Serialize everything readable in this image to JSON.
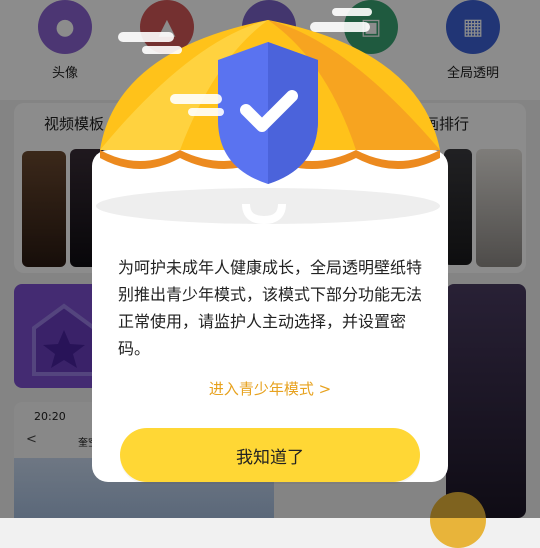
{
  "categories": [
    {
      "label": "头像",
      "icon": "avatar-icon",
      "color": "#8a63d2"
    },
    {
      "label": "",
      "icon": "shirt-icon",
      "color": "#d35858"
    },
    {
      "label": "",
      "icon": "ribbon-icon",
      "color": "#7a63c8"
    },
    {
      "label": "",
      "icon": "lock-icon",
      "color": "#3aa574"
    },
    {
      "label": "全局透明",
      "icon": "grid-icon",
      "color": "#3c62d6"
    }
  ],
  "sections": {
    "video_title": "视频模板",
    "ranking_title": "画排行"
  },
  "phone_preview": {
    "time": "20:20",
    "back_glyph": "<",
    "title": "奎空"
  },
  "dialog": {
    "message": "为呵护未成年人健康成长，全局透明壁纸特别推出青少年模式，该模式下部分功能无法正常使用，请监护人主动选择，并设置密码。",
    "enter_link": "进入青少年模式 >",
    "confirm_button": "我知道了"
  },
  "colors": {
    "accent": "#e7a21f",
    "button": "#ffd735",
    "shield": "#5a73f0",
    "umbrella": "#ffc21a"
  }
}
